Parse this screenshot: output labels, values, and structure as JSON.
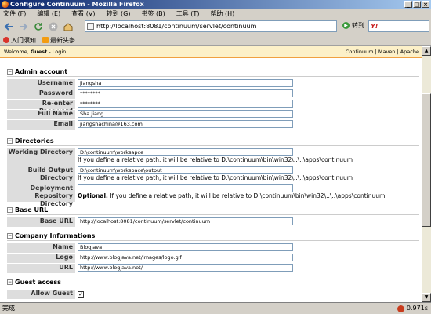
{
  "window": {
    "title": "Configure Continuum - Mozilla Firefox",
    "icon": "firefox-icon"
  },
  "menu": [
    "文件 (F)",
    "编辑 (E)",
    "查看 (V)",
    "转到 (G)",
    "书签 (B)",
    "工具 (T)",
    "帮助 (H)"
  ],
  "toolbar": {
    "url": "http://localhost:8081/continuum/servlet/continuum",
    "go_label": "转到",
    "search_logo": "Y!"
  },
  "bookmarks": [
    {
      "label": "入门须知",
      "icon": "firefox-bookmark-icon"
    },
    {
      "label": "最新头条",
      "icon": "rss-icon"
    }
  ],
  "topbar": {
    "welcome": "Welcome,",
    "guest": "Guest",
    "login": "Login",
    "links": "Continuum | Maven | Apache"
  },
  "admin": {
    "title": "Admin account",
    "fields": [
      {
        "label": "Username",
        "value": "jiangsha"
      },
      {
        "label": "Password",
        "value": "********"
      },
      {
        "label": "Re-enter Password",
        "value": "********"
      },
      {
        "label": "Full Name",
        "value": "Sha Jiang"
      },
      {
        "label": "Email",
        "value": "jiangshachina@163.com"
      }
    ]
  },
  "directories": {
    "title": "Directories",
    "working": {
      "label": "Working Directory",
      "value": "D:\\continuum\\worksapce",
      "hint": "If you define a relative path, it will be relative to D:\\continuum\\bin\\win32\\..\\..\\apps\\continuum"
    },
    "build": {
      "label": "Build Output Directory",
      "value": "D:\\continuum\\workspace\\output",
      "hint": "If you define a relative path, it will be relative to D:\\continuum\\bin\\win32\\..\\..\\apps\\continuum"
    },
    "deploy": {
      "label": "Deployment Repository Directory",
      "value": "",
      "optional": "Optional.",
      "hint": " If you define a relative path, it will be relative to D:\\continuum\\bin\\win32\\..\\..\\apps\\continuum"
    }
  },
  "baseurl": {
    "title": "Base URL",
    "label": "Base URL",
    "value": "http://localhost:8081/continuum/servlet/continuum"
  },
  "company": {
    "title": "Company Informations",
    "fields": [
      {
        "label": "Name",
        "value": "BlogJava"
      },
      {
        "label": "Logo",
        "value": "http://www.blogjava.net/images/logo.gif"
      },
      {
        "label": "URL",
        "value": "http://www.blogjava.net/"
      }
    ]
  },
  "guest": {
    "title": "Guest access",
    "label": "Allow Guest",
    "checked": "✓"
  },
  "status": {
    "text": "完成",
    "time": "0.971s"
  }
}
